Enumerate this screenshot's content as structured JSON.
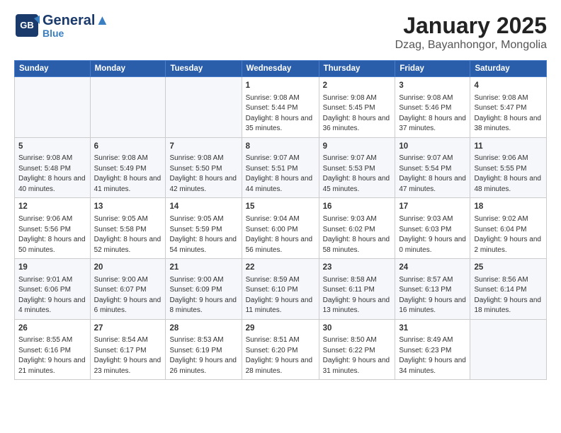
{
  "header": {
    "logo_line1": "General",
    "logo_line2": "Blue",
    "logo_sub": "",
    "title": "January 2025",
    "subtitle": "Dzag, Bayanhongor, Mongolia"
  },
  "weekdays": [
    "Sunday",
    "Monday",
    "Tuesday",
    "Wednesday",
    "Thursday",
    "Friday",
    "Saturday"
  ],
  "weeks": [
    [
      {
        "day": "",
        "info": ""
      },
      {
        "day": "",
        "info": ""
      },
      {
        "day": "",
        "info": ""
      },
      {
        "day": "1",
        "info": "Sunrise: 9:08 AM\nSunset: 5:44 PM\nDaylight: 8 hours\nand 35 minutes."
      },
      {
        "day": "2",
        "info": "Sunrise: 9:08 AM\nSunset: 5:45 PM\nDaylight: 8 hours\nand 36 minutes."
      },
      {
        "day": "3",
        "info": "Sunrise: 9:08 AM\nSunset: 5:46 PM\nDaylight: 8 hours\nand 37 minutes."
      },
      {
        "day": "4",
        "info": "Sunrise: 9:08 AM\nSunset: 5:47 PM\nDaylight: 8 hours\nand 38 minutes."
      }
    ],
    [
      {
        "day": "5",
        "info": "Sunrise: 9:08 AM\nSunset: 5:48 PM\nDaylight: 8 hours\nand 40 minutes."
      },
      {
        "day": "6",
        "info": "Sunrise: 9:08 AM\nSunset: 5:49 PM\nDaylight: 8 hours\nand 41 minutes."
      },
      {
        "day": "7",
        "info": "Sunrise: 9:08 AM\nSunset: 5:50 PM\nDaylight: 8 hours\nand 42 minutes."
      },
      {
        "day": "8",
        "info": "Sunrise: 9:07 AM\nSunset: 5:51 PM\nDaylight: 8 hours\nand 44 minutes."
      },
      {
        "day": "9",
        "info": "Sunrise: 9:07 AM\nSunset: 5:53 PM\nDaylight: 8 hours\nand 45 minutes."
      },
      {
        "day": "10",
        "info": "Sunrise: 9:07 AM\nSunset: 5:54 PM\nDaylight: 8 hours\nand 47 minutes."
      },
      {
        "day": "11",
        "info": "Sunrise: 9:06 AM\nSunset: 5:55 PM\nDaylight: 8 hours\nand 48 minutes."
      }
    ],
    [
      {
        "day": "12",
        "info": "Sunrise: 9:06 AM\nSunset: 5:56 PM\nDaylight: 8 hours\nand 50 minutes."
      },
      {
        "day": "13",
        "info": "Sunrise: 9:05 AM\nSunset: 5:58 PM\nDaylight: 8 hours\nand 52 minutes."
      },
      {
        "day": "14",
        "info": "Sunrise: 9:05 AM\nSunset: 5:59 PM\nDaylight: 8 hours\nand 54 minutes."
      },
      {
        "day": "15",
        "info": "Sunrise: 9:04 AM\nSunset: 6:00 PM\nDaylight: 8 hours\nand 56 minutes."
      },
      {
        "day": "16",
        "info": "Sunrise: 9:03 AM\nSunset: 6:02 PM\nDaylight: 8 hours\nand 58 minutes."
      },
      {
        "day": "17",
        "info": "Sunrise: 9:03 AM\nSunset: 6:03 PM\nDaylight: 9 hours\nand 0 minutes."
      },
      {
        "day": "18",
        "info": "Sunrise: 9:02 AM\nSunset: 6:04 PM\nDaylight: 9 hours\nand 2 minutes."
      }
    ],
    [
      {
        "day": "19",
        "info": "Sunrise: 9:01 AM\nSunset: 6:06 PM\nDaylight: 9 hours\nand 4 minutes."
      },
      {
        "day": "20",
        "info": "Sunrise: 9:00 AM\nSunset: 6:07 PM\nDaylight: 9 hours\nand 6 minutes."
      },
      {
        "day": "21",
        "info": "Sunrise: 9:00 AM\nSunset: 6:09 PM\nDaylight: 9 hours\nand 8 minutes."
      },
      {
        "day": "22",
        "info": "Sunrise: 8:59 AM\nSunset: 6:10 PM\nDaylight: 9 hours\nand 11 minutes."
      },
      {
        "day": "23",
        "info": "Sunrise: 8:58 AM\nSunset: 6:11 PM\nDaylight: 9 hours\nand 13 minutes."
      },
      {
        "day": "24",
        "info": "Sunrise: 8:57 AM\nSunset: 6:13 PM\nDaylight: 9 hours\nand 16 minutes."
      },
      {
        "day": "25",
        "info": "Sunrise: 8:56 AM\nSunset: 6:14 PM\nDaylight: 9 hours\nand 18 minutes."
      }
    ],
    [
      {
        "day": "26",
        "info": "Sunrise: 8:55 AM\nSunset: 6:16 PM\nDaylight: 9 hours\nand 21 minutes."
      },
      {
        "day": "27",
        "info": "Sunrise: 8:54 AM\nSunset: 6:17 PM\nDaylight: 9 hours\nand 23 minutes."
      },
      {
        "day": "28",
        "info": "Sunrise: 8:53 AM\nSunset: 6:19 PM\nDaylight: 9 hours\nand 26 minutes."
      },
      {
        "day": "29",
        "info": "Sunrise: 8:51 AM\nSunset: 6:20 PM\nDaylight: 9 hours\nand 28 minutes."
      },
      {
        "day": "30",
        "info": "Sunrise: 8:50 AM\nSunset: 6:22 PM\nDaylight: 9 hours\nand 31 minutes."
      },
      {
        "day": "31",
        "info": "Sunrise: 8:49 AM\nSunset: 6:23 PM\nDaylight: 9 hours\nand 34 minutes."
      },
      {
        "day": "",
        "info": ""
      }
    ]
  ]
}
